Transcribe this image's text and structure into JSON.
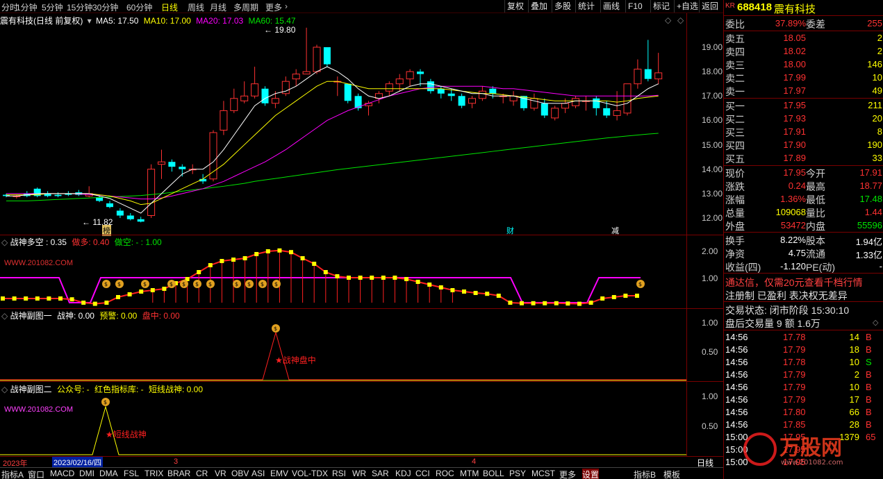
{
  "toolbar": {
    "tabs": [
      "分时",
      "1分钟",
      "5分钟",
      "15分钟",
      "30分钟",
      "60分钟",
      "日线",
      "周线",
      "月线",
      "多周期",
      "更多"
    ],
    "active_tab": "日线",
    "buttons": [
      "复权",
      "叠加",
      "多股",
      "统计",
      "画线",
      "F10",
      "标记",
      "+自选",
      "返回"
    ]
  },
  "main_chart": {
    "title": "震有科技(日线 前复权)",
    "ma5": "MA5: 17.50",
    "ma10": "MA10: 17.00",
    "ma20": "MA20: 17.03",
    "ma60": "MA60: 15.47",
    "high_label": "19.80",
    "low_label": "11.82",
    "yticks": [
      "19.00",
      "18.00",
      "17.00",
      "16.00",
      "15.00",
      "14.00",
      "13.00",
      "12.00"
    ],
    "event_marks": [
      "榜",
      "财",
      "减"
    ]
  },
  "panel1": {
    "name": "战神多空",
    "val": ": 0.35",
    "zuoduo": "做多: 0.40",
    "zuokong": "做空: - : 1.00",
    "watermark": "WWW.201082.COM",
    "yticks": [
      "2.00",
      "1.00"
    ]
  },
  "panel2": {
    "name": "战神副图一",
    "zhanshen": "战神: 0.00",
    "yujing": "预警: 0.00",
    "panzhong": "盘中: 0.00",
    "label": "战神盘中",
    "yticks": [
      "1.00",
      "0.50"
    ]
  },
  "panel3": {
    "name": "战神副图二",
    "gzh": "公众号: -",
    "lib": "红色指标库: -",
    "dxzs": "短线战神: 0.00",
    "watermark": "WWW.201082.COM",
    "label": "短线战神",
    "yticks": [
      "1.00",
      "0.50"
    ]
  },
  "datebar": {
    "year": "2023年",
    "date": "2023/02/16/四",
    "m3": "3",
    "m4": "4",
    "period": "日线"
  },
  "bottom_tabs": [
    "指标A",
    "窗口",
    "MACD",
    "DMI",
    "DMA",
    "FSL",
    "TRIX",
    "BRAR",
    "CR",
    "VR",
    "OBV",
    "ASI",
    "EMV",
    "VOL-TDX",
    "RSI",
    "WR",
    "SAR",
    "KDJ",
    "CCI",
    "ROC",
    "MTM",
    "BOLL",
    "PSY",
    "MCST",
    "更多",
    "设置",
    "指标B",
    "模板"
  ],
  "quote": {
    "kr": "KR",
    "code": "688418",
    "name": "震有科技",
    "weibi_label": "委比",
    "weibi": "37.89%",
    "weicha_label": "委差",
    "weicha": "255",
    "sells": [
      {
        "label": "卖五",
        "price": "18.05",
        "vol": "2"
      },
      {
        "label": "卖四",
        "price": "18.02",
        "vol": "2"
      },
      {
        "label": "卖三",
        "price": "18.00",
        "vol": "146"
      },
      {
        "label": "卖二",
        "price": "17.99",
        "vol": "10"
      },
      {
        "label": "卖一",
        "price": "17.97",
        "vol": "49"
      }
    ],
    "buys": [
      {
        "label": "买一",
        "price": "17.95",
        "vol": "211"
      },
      {
        "label": "买二",
        "price": "17.93",
        "vol": "20"
      },
      {
        "label": "买三",
        "price": "17.91",
        "vol": "8"
      },
      {
        "label": "买四",
        "price": "17.90",
        "vol": "190"
      },
      {
        "label": "买五",
        "price": "17.89",
        "vol": "33"
      }
    ],
    "stats": [
      {
        "l1": "现价",
        "v1": "17.95",
        "c1": "red",
        "l2": "今开",
        "v2": "17.91",
        "c2": "red"
      },
      {
        "l1": "涨跌",
        "v1": "0.24",
        "c1": "red",
        "l2": "最高",
        "v2": "18.77",
        "c2": "red"
      },
      {
        "l1": "涨幅",
        "v1": "1.36%",
        "c1": "red",
        "l2": "最低",
        "v2": "17.48",
        "c2": "green"
      },
      {
        "l1": "总量",
        "v1": "109068",
        "c1": "yellow",
        "l2": "量比",
        "v2": "1.44",
        "c2": "red"
      },
      {
        "l1": "外盘",
        "v1": "53472",
        "c1": "red",
        "l2": "内盘",
        "v2": "55596",
        "c2": "green"
      }
    ],
    "stats2": [
      {
        "l1": "换手",
        "v1": "8.22%",
        "l2": "股本",
        "v2": "1.94亿"
      },
      {
        "l1": "净资",
        "v1": "4.75",
        "l2": "流通",
        "v2": "1.33亿"
      },
      {
        "l1": "收益(四)",
        "v1": "-1.120",
        "l2": "PE(动)",
        "v2": "-"
      }
    ],
    "ad1": "通达信，仅需20元查看千档行情",
    "ad2": "注册制 已盈利 表决权无差异",
    "status": "交易状态: 闭市阶段 15:30:10",
    "after": "盘后交易量 9 额 1.6万",
    "ticks": [
      {
        "t": "14:56",
        "p": "17.78",
        "v": "14",
        "s": "B"
      },
      {
        "t": "14:56",
        "p": "17.79",
        "v": "18",
        "s": "B"
      },
      {
        "t": "14:56",
        "p": "17.78",
        "v": "10",
        "s": "S"
      },
      {
        "t": "14:56",
        "p": "17.79",
        "v": "2",
        "s": "B"
      },
      {
        "t": "14:56",
        "p": "17.79",
        "v": "10",
        "s": "B"
      },
      {
        "t": "14:56",
        "p": "17.79",
        "v": "17",
        "s": "B"
      },
      {
        "t": "14:56",
        "p": "17.80",
        "v": "66",
        "s": "B"
      },
      {
        "t": "14:56",
        "p": "17.85",
        "v": "28",
        "s": "B"
      },
      {
        "t": "15:00",
        "p": "17.95",
        "v": "1379",
        "s": "65"
      },
      {
        "t": "15:00",
        "p": "17.95",
        "v": "",
        "s": ""
      },
      {
        "t": "15:00",
        "p": "17.95",
        "v": "",
        "s": ""
      }
    ],
    "logo": "万股网",
    "logo_url": "www.201082.com"
  },
  "colors": {
    "up": "#ff3232",
    "down": "#00ffff",
    "ma5": "#ffffff",
    "ma10": "#ffff00",
    "ma20": "#ff00ff",
    "ma60": "#00e600",
    "border": "#7a0000"
  }
}
